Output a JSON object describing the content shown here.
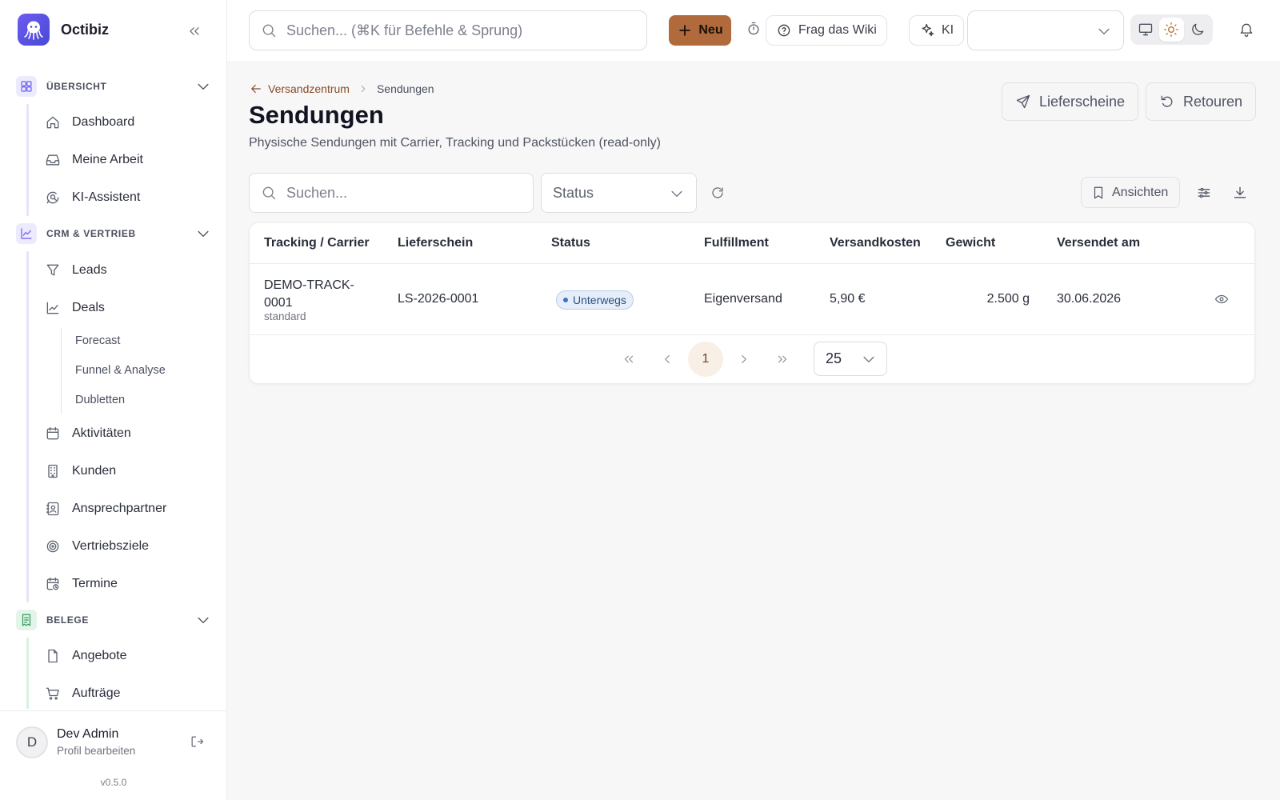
{
  "app": {
    "name": "Octibiz",
    "version": "v0.5.0"
  },
  "topbar": {
    "search_placeholder": "Suchen... (⌘K für Befehle & Sprung)",
    "new_label": "Neu",
    "wiki_label": "Frag das Wiki",
    "ai_label": "KI",
    "tenant_select_value": ""
  },
  "sidebar": {
    "sections": [
      {
        "label": "ÜBERSICHT",
        "icon": "grid-icon",
        "color": "#6a5cf0",
        "items": [
          {
            "label": "Dashboard",
            "icon": "home-icon"
          },
          {
            "label": "Meine Arbeit",
            "icon": "inbox-icon"
          },
          {
            "label": "KI-Assistent",
            "icon": "chat-search-icon"
          }
        ]
      },
      {
        "label": "CRM & VERTRIEB",
        "icon": "chart-icon",
        "color": "#6a5cf0",
        "items": [
          {
            "label": "Leads",
            "icon": "filter-icon"
          },
          {
            "label": "Deals",
            "icon": "trend-icon",
            "subitems": [
              "Forecast",
              "Funnel & Analyse",
              "Dubletten"
            ]
          },
          {
            "label": "Aktivitäten",
            "icon": "calendar-icon"
          },
          {
            "label": "Kunden",
            "icon": "building-icon"
          },
          {
            "label": "Ansprechpartner",
            "icon": "contact-icon"
          },
          {
            "label": "Vertriebsziele",
            "icon": "target-icon"
          },
          {
            "label": "Termine",
            "icon": "calendar-clock-icon"
          }
        ]
      },
      {
        "label": "BELEGE",
        "icon": "receipt-icon",
        "color": "#2f9a5a",
        "items": [
          {
            "label": "Angebote",
            "icon": "file-icon"
          },
          {
            "label": "Aufträge",
            "icon": "cart-icon"
          }
        ]
      }
    ],
    "user": {
      "initial": "D",
      "name": "Dev Admin",
      "sub": "Profil bearbeiten"
    }
  },
  "page": {
    "breadcrumb": {
      "parent": "Versandzentrum",
      "current": "Sendungen"
    },
    "title": "Sendungen",
    "subtitle": "Physische Sendungen mit Carrier, Tracking und Packstücken (read-only)",
    "actions": {
      "delivery_notes": "Lieferscheine",
      "returns": "Retouren"
    },
    "filters": {
      "search_placeholder": "Suchen...",
      "status_placeholder": "Status",
      "views_label": "Ansichten"
    }
  },
  "table": {
    "columns": [
      "Tracking / Carrier",
      "Lieferschein",
      "Status",
      "Fulfillment",
      "Versandkosten",
      "Gewicht",
      "Versendet am"
    ],
    "rows": [
      {
        "tracking_line1": "DEMO-TRACK-",
        "tracking_line2": "0001",
        "carrier": "standard",
        "delivery_note": "LS-2026-0001",
        "status": "Unterwegs",
        "fulfillment": "Eigenversand",
        "cost": "5,90 €",
        "weight": "2.500 g",
        "shipped_at": "30.06.2026"
      }
    ],
    "pagination": {
      "current_page": "1",
      "page_size": "25"
    }
  }
}
